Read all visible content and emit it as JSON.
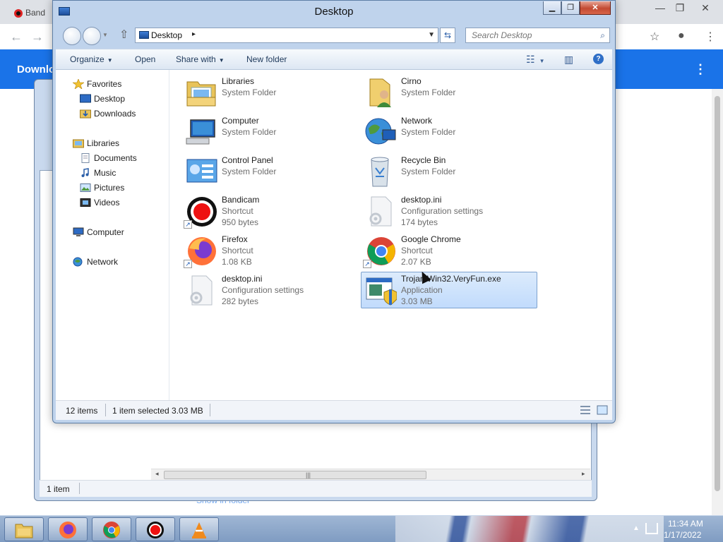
{
  "browser": {
    "tab_label": "Band",
    "window_controls": [
      "—",
      "❐",
      "✕"
    ],
    "banner_title": "Downlo",
    "link_text": "Show in folder",
    "accent": "#1a73e8"
  },
  "bg_window": {
    "status_count": "1 item"
  },
  "window": {
    "title": "Desktop",
    "controls": {
      "minimize": "▁",
      "maximize": "❐",
      "close": "✕"
    },
    "address": {
      "location": "Desktop",
      "chevron": "▸"
    },
    "search": {
      "placeholder": "Search Desktop"
    },
    "commands": {
      "organize": "Organize",
      "open": "Open",
      "share_with": "Share with",
      "new_folder": "New folder"
    },
    "nav": {
      "favorites": "Favorites",
      "desktop": "Desktop",
      "downloads": "Downloads",
      "libraries": "Libraries",
      "documents": "Documents",
      "music": "Music",
      "pictures": "Pictures",
      "videos": "Videos",
      "computer": "Computer",
      "network": "Network"
    },
    "items": [
      {
        "name": "Libraries",
        "type": "System Folder",
        "size": "",
        "icon": "libraries-icon"
      },
      {
        "name": "Cirno",
        "type": "System Folder",
        "size": "",
        "icon": "user-folder-icon"
      },
      {
        "name": "Computer",
        "type": "System Folder",
        "size": "",
        "icon": "computer-icon"
      },
      {
        "name": "Network",
        "type": "System Folder",
        "size": "",
        "icon": "network-icon"
      },
      {
        "name": "Control Panel",
        "type": "System Folder",
        "size": "",
        "icon": "control-panel-icon"
      },
      {
        "name": "Recycle Bin",
        "type": "System Folder",
        "size": "",
        "icon": "recycle-bin-icon"
      },
      {
        "name": "Bandicam",
        "type": "Shortcut",
        "size": "950 bytes",
        "icon": "bandicam-icon"
      },
      {
        "name": "desktop.ini",
        "type": "Configuration settings",
        "size": "174 bytes",
        "icon": "config-file-icon"
      },
      {
        "name": "Firefox",
        "type": "Shortcut",
        "size": "1.08 KB",
        "icon": "firefox-icon"
      },
      {
        "name": "Google Chrome",
        "type": "Shortcut",
        "size": "2.07 KB",
        "icon": "chrome-icon"
      },
      {
        "name": "desktop.ini",
        "type": "Configuration settings",
        "size": "282 bytes",
        "icon": "config-file-icon"
      },
      {
        "name": "Trojan.Win32.VeryFun.exe",
        "type": "Application",
        "size": "3.03 MB",
        "icon": "application-icon",
        "selected": true
      }
    ],
    "status": {
      "count": "12 items",
      "selection": "1 item selected  3.03 MB"
    },
    "selection_color": "#c1dbfc"
  },
  "taskbar": {
    "time": "11:34 AM",
    "date": "1/17/2022",
    "buttons": [
      "explorer-icon",
      "firefox-icon",
      "chrome-icon",
      "bandicam-icon",
      "vlc-icon"
    ]
  }
}
